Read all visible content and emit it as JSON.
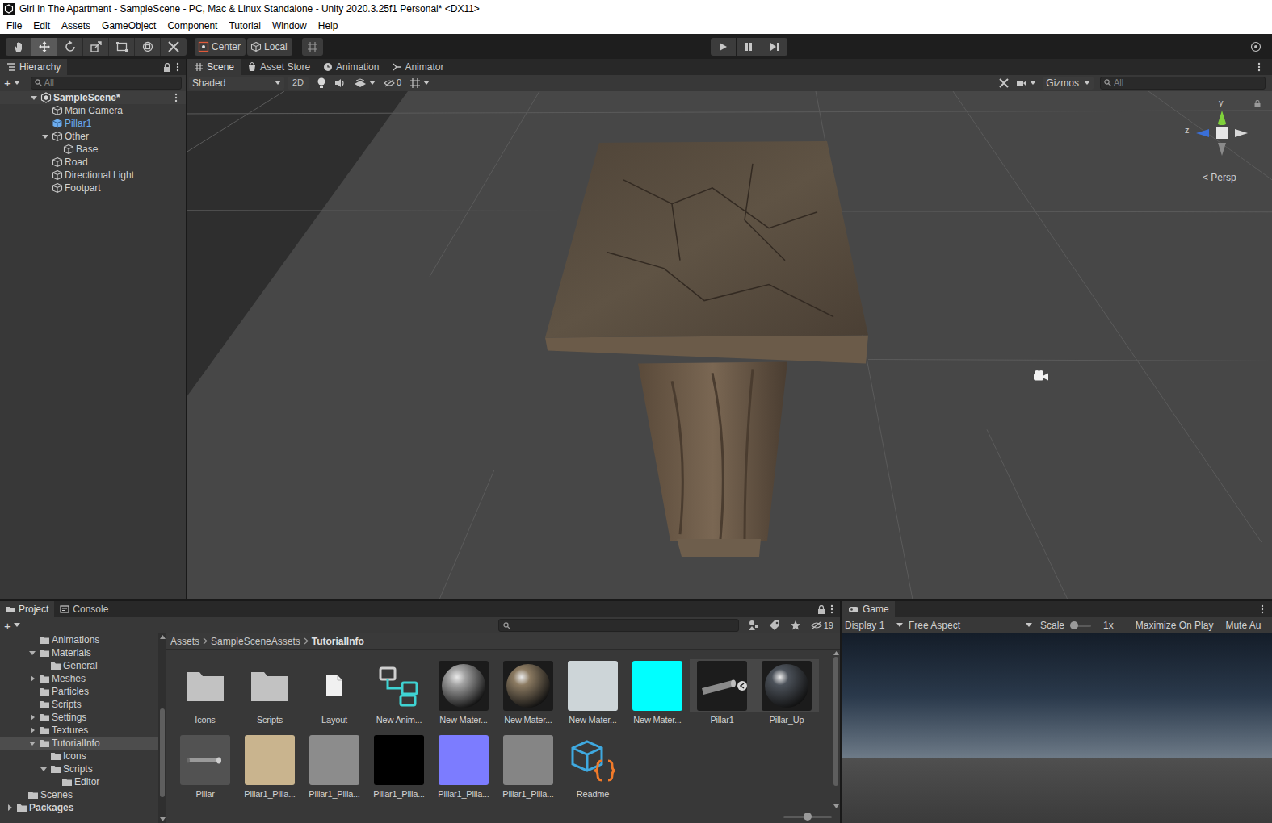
{
  "window": {
    "title": "Girl In The Apartment - SampleScene - PC, Mac & Linux Standalone - Unity 2020.3.25f1 Personal* <DX11>"
  },
  "menu": [
    "File",
    "Edit",
    "Assets",
    "GameObject",
    "Component",
    "Tutorial",
    "Window",
    "Help"
  ],
  "toolbar": {
    "tools": [
      {
        "selected": false
      },
      {
        "selected": true
      },
      {
        "selected": false
      },
      {
        "selected": false
      },
      {
        "selected": false
      },
      {
        "selected": false
      },
      {
        "selected": false
      }
    ],
    "pivot": "Center",
    "space": "Local"
  },
  "hierarchy": {
    "tab": "Hierarchy",
    "add": "+",
    "search": "All",
    "items": [
      {
        "label": "SampleScene*",
        "depth": 0,
        "kind": "scene",
        "expandable": true,
        "expanded": true,
        "prefab": false
      },
      {
        "label": "Main Camera",
        "depth": 1,
        "kind": "object",
        "expandable": false,
        "expanded": false,
        "prefab": false
      },
      {
        "label": "Pillar1",
        "depth": 1,
        "kind": "object",
        "expandable": false,
        "expanded": false,
        "prefab": true
      },
      {
        "label": "Other",
        "depth": 1,
        "kind": "object",
        "expandable": true,
        "expanded": true,
        "prefab": false
      },
      {
        "label": "Base",
        "depth": 2,
        "kind": "object",
        "expandable": false,
        "expanded": false,
        "prefab": false
      },
      {
        "label": "Road",
        "depth": 1,
        "kind": "object",
        "expandable": false,
        "expanded": false,
        "prefab": false
      },
      {
        "label": "Directional Light",
        "depth": 1,
        "kind": "object",
        "expandable": false,
        "expanded": false,
        "prefab": false
      },
      {
        "label": "Footpart",
        "depth": 1,
        "kind": "object",
        "expandable": false,
        "expanded": false,
        "prefab": false
      }
    ]
  },
  "scene": {
    "tabs": [
      {
        "label": "Scene",
        "selected": true
      },
      {
        "label": "Asset Store",
        "selected": false
      },
      {
        "label": "Animation",
        "selected": false
      },
      {
        "label": "Animator",
        "selected": false
      }
    ],
    "shading": "Shaded",
    "mode2d": {
      "label": "2D",
      "on": false
    },
    "hidden": "0",
    "gizmos": "Gizmos",
    "search": "All",
    "axes": {
      "y": "y",
      "z": "z"
    },
    "projection": "< Persp"
  },
  "project": {
    "tabs": [
      {
        "label": "Project",
        "selected": true
      },
      {
        "label": "Console",
        "selected": false
      }
    ],
    "add": "+",
    "hidden": "19",
    "breadcrumb": [
      "Assets",
      "SampleSceneAssets",
      "TutorialInfo"
    ],
    "tree": [
      {
        "label": "Animations",
        "depth": 2,
        "expandable": false,
        "expanded": false,
        "selected": false
      },
      {
        "label": "Materials",
        "depth": 2,
        "expandable": true,
        "expanded": true,
        "selected": false
      },
      {
        "label": "General",
        "depth": 3,
        "expandable": false,
        "expanded": false,
        "selected": false
      },
      {
        "label": "Meshes",
        "depth": 2,
        "expandable": true,
        "expanded": false,
        "selected": false
      },
      {
        "label": "Particles",
        "depth": 2,
        "expandable": false,
        "expanded": false,
        "selected": false
      },
      {
        "label": "Scripts",
        "depth": 2,
        "expandable": false,
        "expanded": false,
        "selected": false
      },
      {
        "label": "Settings",
        "depth": 2,
        "expandable": true,
        "expanded": false,
        "selected": false
      },
      {
        "label": "Textures",
        "depth": 2,
        "expandable": true,
        "expanded": false,
        "selected": false
      },
      {
        "label": "TutorialInfo",
        "depth": 2,
        "expandable": true,
        "expanded": true,
        "selected": true
      },
      {
        "label": "Icons",
        "depth": 3,
        "expandable": false,
        "expanded": false,
        "selected": false
      },
      {
        "label": "Scripts",
        "depth": 3,
        "expandable": true,
        "expanded": true,
        "selected": false
      },
      {
        "label": "Editor",
        "depth": 4,
        "expandable": false,
        "expanded": false,
        "selected": false
      },
      {
        "label": "Scenes",
        "depth": 1,
        "expandable": false,
        "expanded": false,
        "selected": false
      },
      {
        "label": "Packages",
        "depth": 0,
        "expandable": true,
        "expanded": false,
        "selected": false
      }
    ],
    "assets": [
      {
        "label": "Icons",
        "kind": "folder",
        "color": "#c2c2c2",
        "grouped": false
      },
      {
        "label": "Scripts",
        "kind": "folder",
        "color": "#c2c2c2",
        "grouped": false
      },
      {
        "label": "Layout",
        "kind": "file",
        "color": "#f0f0f0",
        "grouped": false
      },
      {
        "label": "New Anim...",
        "kind": "animator",
        "color": "#3fd3d3",
        "grouped": false
      },
      {
        "label": "New Mater...",
        "kind": "sphere",
        "color": "#a3a3a3",
        "grouped": false
      },
      {
        "label": "New Mater...",
        "kind": "sphere",
        "color": "#8c7b62",
        "grouped": false
      },
      {
        "label": "New Mater...",
        "kind": "swatch",
        "color": "#cdd5d8",
        "grouped": false
      },
      {
        "label": "New Mater...",
        "kind": "swatch",
        "color": "#00ffff",
        "grouped": false
      },
      {
        "label": "Pillar1",
        "kind": "model",
        "color": "#8a8a8a",
        "grouped": true
      },
      {
        "label": "Pillar_Up",
        "kind": "sphere",
        "color": "#4c525a",
        "grouped": true
      },
      {
        "label": "Pillar",
        "kind": "prefab",
        "color": "#9a9a9a",
        "grouped": false
      },
      {
        "label": "Pillar1_Pilla...",
        "kind": "swatch",
        "color": "#c9b48e",
        "grouped": false
      },
      {
        "label": "Pillar1_Pilla...",
        "kind": "swatch",
        "color": "#8c8c8c",
        "grouped": false
      },
      {
        "label": "Pillar1_Pilla...",
        "kind": "swatch",
        "color": "#000000",
        "grouped": false
      },
      {
        "label": "Pillar1_Pilla...",
        "kind": "swatch",
        "color": "#7c7cff",
        "grouped": false
      },
      {
        "label": "Pillar1_Pilla...",
        "kind": "swatch",
        "color": "#858585",
        "grouped": false
      },
      {
        "label": "Readme",
        "kind": "readme",
        "color": "#3fa9e0",
        "grouped": false
      }
    ],
    "thumbSize": 0.5
  },
  "game": {
    "tab": "Game",
    "display": "Display 1",
    "aspect": "Free Aspect",
    "scaleLabel": "Scale",
    "scaleLevel": 0,
    "scale": "1x",
    "maximize": "Maximize On Play",
    "mute": "Mute Au"
  }
}
